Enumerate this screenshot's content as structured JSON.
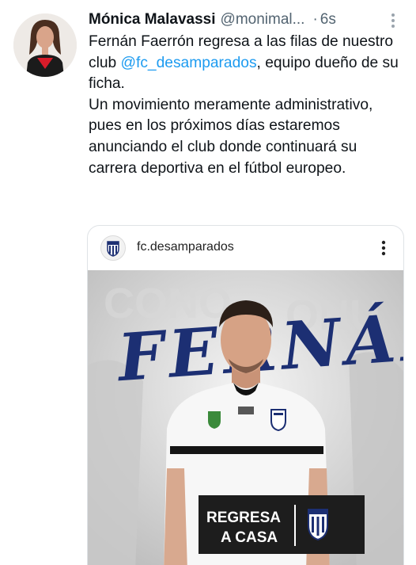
{
  "tweet": {
    "display_name": "Mónica Malavassi",
    "handle": "@monimal...",
    "separator": "·",
    "time": "6s",
    "paragraph1": {
      "before": "Fernán Faerrón regresa a las filas de nuestro club ",
      "mention": "@fc_desamparados",
      "after": ", equipo dueño de su ficha."
    },
    "paragraph2": "Un movimiento meramente administrativo, pues en los próximos días estaremos anunciando el club donde continuará su carrera deportiva en el fútbol europeo."
  },
  "card": {
    "username": "fc.desamparados",
    "poster": {
      "player_name": "FERNÁN",
      "banner_line1": "REGRESA",
      "banner_line2": "A CASA"
    }
  },
  "colors": {
    "text": "#0f1419",
    "secondary": "#536471",
    "link": "#1d9bf0",
    "script_navy": "#1c2f73",
    "banner_bg": "#1d1d1d"
  },
  "icons": [
    "avatar-photo",
    "more-vertical-icon",
    "club-crest-icon",
    "more-vertical-icon"
  ]
}
